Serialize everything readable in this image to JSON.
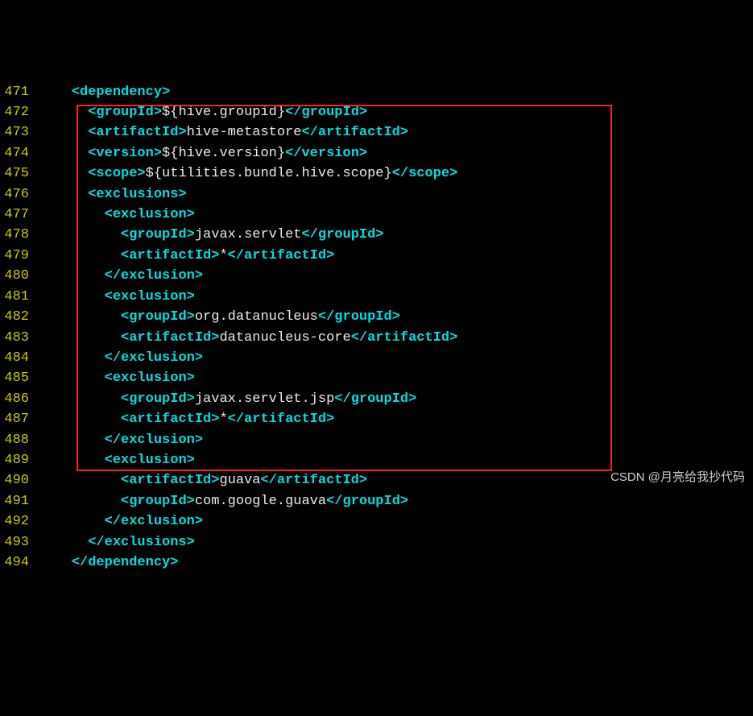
{
  "colors": {
    "background": "#000000",
    "lineNumber": "#cccc00",
    "tag": "#00dede",
    "text": "#eaeaea",
    "highlightBox": "#ff2020"
  },
  "watermark": "CSDN @月亮给我抄代码",
  "highlightRange": {
    "startLine": 476,
    "endLine": 493
  },
  "lines": [
    {
      "num": "471",
      "indent": 4,
      "tokens": [
        [
          "tag",
          "<dependency>"
        ]
      ]
    },
    {
      "num": "472",
      "indent": 6,
      "tokens": [
        [
          "tag",
          "<groupId>"
        ],
        [
          "txt",
          "${hive.groupid}"
        ],
        [
          "tag",
          "</groupId>"
        ]
      ]
    },
    {
      "num": "473",
      "indent": 6,
      "tokens": [
        [
          "tag",
          "<artifactId>"
        ],
        [
          "txt",
          "hive-metastore"
        ],
        [
          "tag",
          "</artifactId>"
        ]
      ]
    },
    {
      "num": "474",
      "indent": 6,
      "tokens": [
        [
          "tag",
          "<version>"
        ],
        [
          "txt",
          "${hive.version}"
        ],
        [
          "tag",
          "</version>"
        ]
      ]
    },
    {
      "num": "475",
      "indent": 6,
      "tokens": [
        [
          "tag",
          "<scope>"
        ],
        [
          "txt",
          "${utilities.bundle.hive.scope}"
        ],
        [
          "tag",
          "</scope>"
        ]
      ]
    },
    {
      "num": "476",
      "indent": 6,
      "tokens": [
        [
          "tag",
          "<exclusions>"
        ]
      ]
    },
    {
      "num": "477",
      "indent": 8,
      "tokens": [
        [
          "tag",
          "<exclusion>"
        ]
      ]
    },
    {
      "num": "478",
      "indent": 10,
      "tokens": [
        [
          "tag",
          "<groupId>"
        ],
        [
          "txt",
          "javax.servlet"
        ],
        [
          "tag",
          "</groupId>"
        ]
      ]
    },
    {
      "num": "479",
      "indent": 10,
      "tokens": [
        [
          "tag",
          "<artifactId>"
        ],
        [
          "txt",
          "*"
        ],
        [
          "tag",
          "</artifactId>"
        ]
      ]
    },
    {
      "num": "480",
      "indent": 8,
      "tokens": [
        [
          "tag",
          "</exclusion>"
        ]
      ]
    },
    {
      "num": "481",
      "indent": 8,
      "tokens": [
        [
          "tag",
          "<exclusion>"
        ]
      ]
    },
    {
      "num": "482",
      "indent": 10,
      "tokens": [
        [
          "tag",
          "<groupId>"
        ],
        [
          "txt",
          "org.datanucleus"
        ],
        [
          "tag",
          "</groupId>"
        ]
      ]
    },
    {
      "num": "483",
      "indent": 10,
      "tokens": [
        [
          "tag",
          "<artifactId>"
        ],
        [
          "txt",
          "datanucleus-core"
        ],
        [
          "tag",
          "</artifactId>"
        ]
      ]
    },
    {
      "num": "484",
      "indent": 8,
      "tokens": [
        [
          "tag",
          "</exclusion>"
        ]
      ]
    },
    {
      "num": "485",
      "indent": 8,
      "tokens": [
        [
          "tag",
          "<exclusion>"
        ]
      ]
    },
    {
      "num": "486",
      "indent": 10,
      "tokens": [
        [
          "tag",
          "<groupId>"
        ],
        [
          "txt",
          "javax.servlet.jsp"
        ],
        [
          "tag",
          "</groupId>"
        ]
      ]
    },
    {
      "num": "487",
      "indent": 10,
      "tokens": [
        [
          "tag",
          "<artifactId>"
        ],
        [
          "txt",
          "*"
        ],
        [
          "tag",
          "</artifactId>"
        ]
      ]
    },
    {
      "num": "488",
      "indent": 8,
      "tokens": [
        [
          "tag",
          "</exclusion>"
        ]
      ]
    },
    {
      "num": "489",
      "indent": 8,
      "tokens": [
        [
          "tag",
          "<exclusion>"
        ]
      ]
    },
    {
      "num": "490",
      "indent": 10,
      "tokens": [
        [
          "tag",
          "<artifactId>"
        ],
        [
          "txt",
          "guava"
        ],
        [
          "tag",
          "</artifactId>"
        ]
      ]
    },
    {
      "num": "491",
      "indent": 10,
      "tokens": [
        [
          "tag",
          "<groupId>"
        ],
        [
          "txt",
          "com.google.guava"
        ],
        [
          "tag",
          "</groupId>"
        ]
      ]
    },
    {
      "num": "492",
      "indent": 8,
      "tokens": [
        [
          "tag",
          "</exclusion>"
        ]
      ]
    },
    {
      "num": "493",
      "indent": 6,
      "tokens": [
        [
          "tag",
          "</exclusions>"
        ]
      ]
    },
    {
      "num": "494",
      "indent": 4,
      "tokens": [
        [
          "tag",
          "</dependency>"
        ]
      ]
    }
  ]
}
